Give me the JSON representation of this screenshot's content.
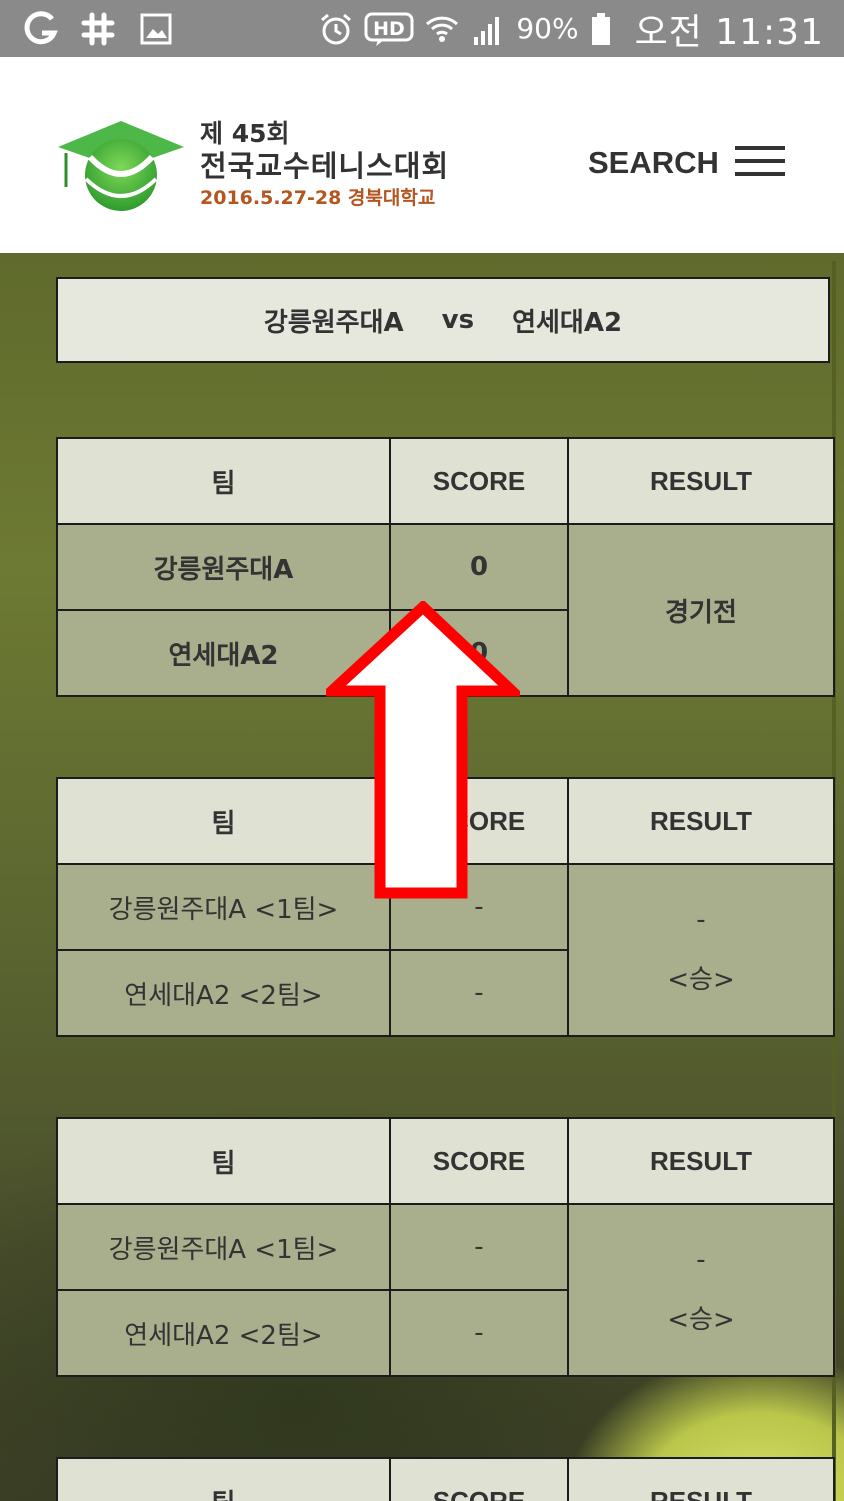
{
  "status_bar": {
    "battery": "90%",
    "time": "오전 11:31",
    "icons": [
      "g-icon",
      "slack-icon",
      "image-icon",
      "alarm-icon",
      "hd-icon",
      "wifi-icon",
      "signal-icon",
      "battery-icon"
    ]
  },
  "header": {
    "logo": {
      "line1": "제 45회",
      "line2": "전국교수테니스대회",
      "line3": "2016.5.27-28 경북대학교"
    },
    "search_label": "SEARCH"
  },
  "match": {
    "team_a": "강릉원주대A",
    "vs": "vs",
    "team_b": "연세대A2"
  },
  "tables": [
    {
      "headers": [
        "팀",
        "SCORE",
        "RESULT"
      ],
      "rows": [
        {
          "team": "강릉원주대A",
          "score": "0"
        },
        {
          "team": "연세대A2",
          "score": "0"
        }
      ],
      "result_line1": "경기전",
      "result_line2": ""
    },
    {
      "headers": [
        "팀",
        "SCORE",
        "RESULT"
      ],
      "rows": [
        {
          "team": "강릉원주대A <1팀>",
          "score": "-"
        },
        {
          "team": "연세대A2 <2팀>",
          "score": "-"
        }
      ],
      "result_line1": "-",
      "result_line2": "<승>"
    },
    {
      "headers": [
        "팀",
        "SCORE",
        "RESULT"
      ],
      "rows": [
        {
          "team": "강릉원주대A <1팀>",
          "score": "-"
        },
        {
          "team": "연세대A2 <2팀>",
          "score": "-"
        }
      ],
      "result_line1": "-",
      "result_line2": "<승>"
    },
    {
      "headers": [
        "팀",
        "SCORE",
        "RESULT"
      ]
    }
  ],
  "colors": {
    "statusbar": "#8a8a8a",
    "header_cell": "#dfe1d3",
    "body_cell": "#a9ae8d",
    "logo_green": "#3fae3a",
    "arrow_red": "#ff0000"
  }
}
